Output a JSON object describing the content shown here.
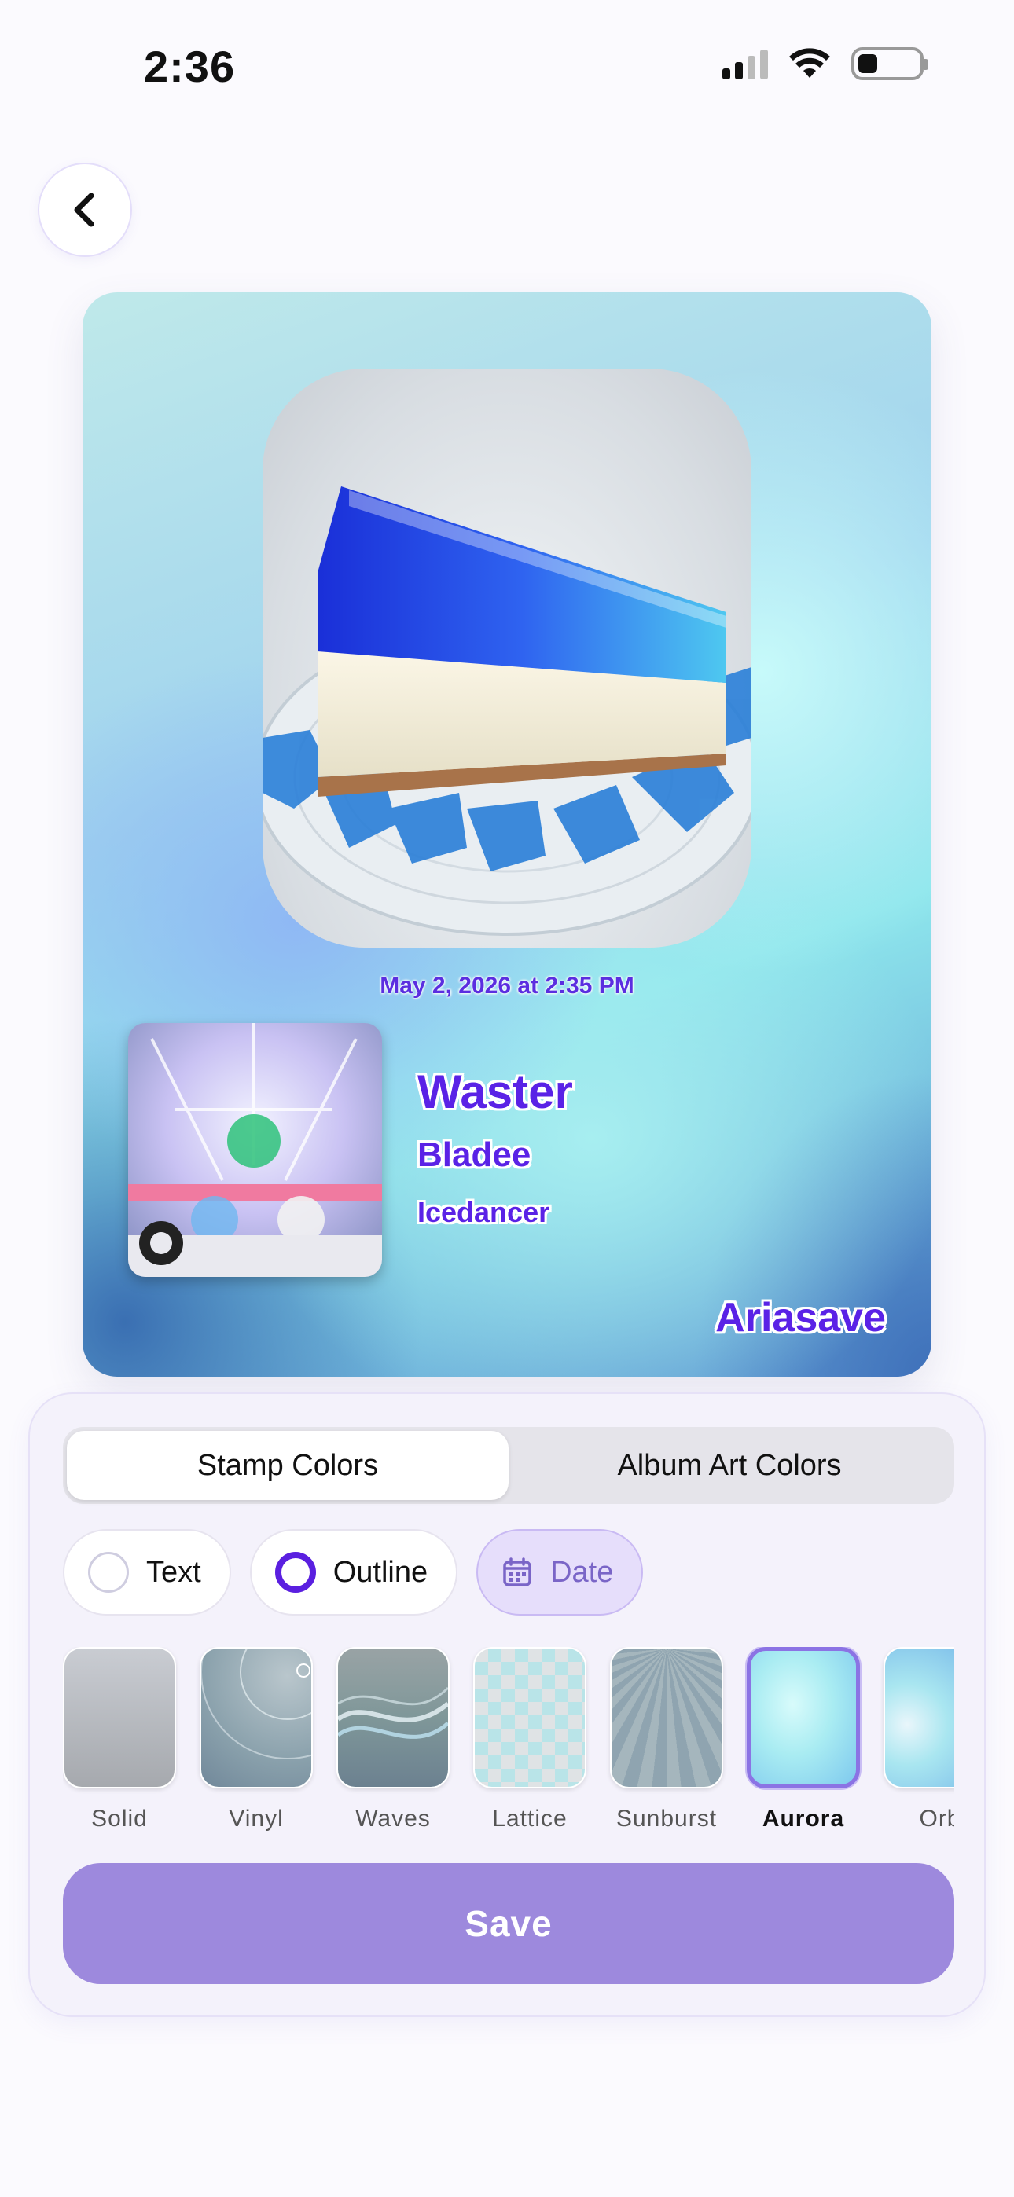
{
  "status_bar": {
    "time": "2:36",
    "signal_icon": "cellular-signal-icon",
    "wifi_icon": "wifi-icon",
    "battery_icon": "battery-low-icon"
  },
  "nav": {
    "back_icon": "chevron-left-icon"
  },
  "stamp": {
    "photo_alt": "blue jelly cheesecake",
    "date": "May 2, 2026 at 2:35 PM",
    "track_title": "Waster",
    "artist": "Bladee",
    "album": "Icedancer",
    "brand": "Ariasave",
    "text_color": "#5a22e6"
  },
  "editor": {
    "tabs": [
      {
        "label": "Stamp Colors",
        "active": true
      },
      {
        "label": "Album Art Colors",
        "active": false
      }
    ],
    "chips": [
      {
        "label": "Text",
        "selected": false
      },
      {
        "label": "Outline",
        "selected": true
      },
      {
        "label": "Date",
        "icon": "calendar-icon"
      }
    ],
    "backgrounds": [
      {
        "label": "Solid"
      },
      {
        "label": "Vinyl"
      },
      {
        "label": "Waves"
      },
      {
        "label": "Lattice"
      },
      {
        "label": "Sunburst"
      },
      {
        "label": "Aurora",
        "selected": true
      },
      {
        "label": "Orb"
      }
    ],
    "save_label": "Save",
    "accent_color": "#9d89dd"
  }
}
